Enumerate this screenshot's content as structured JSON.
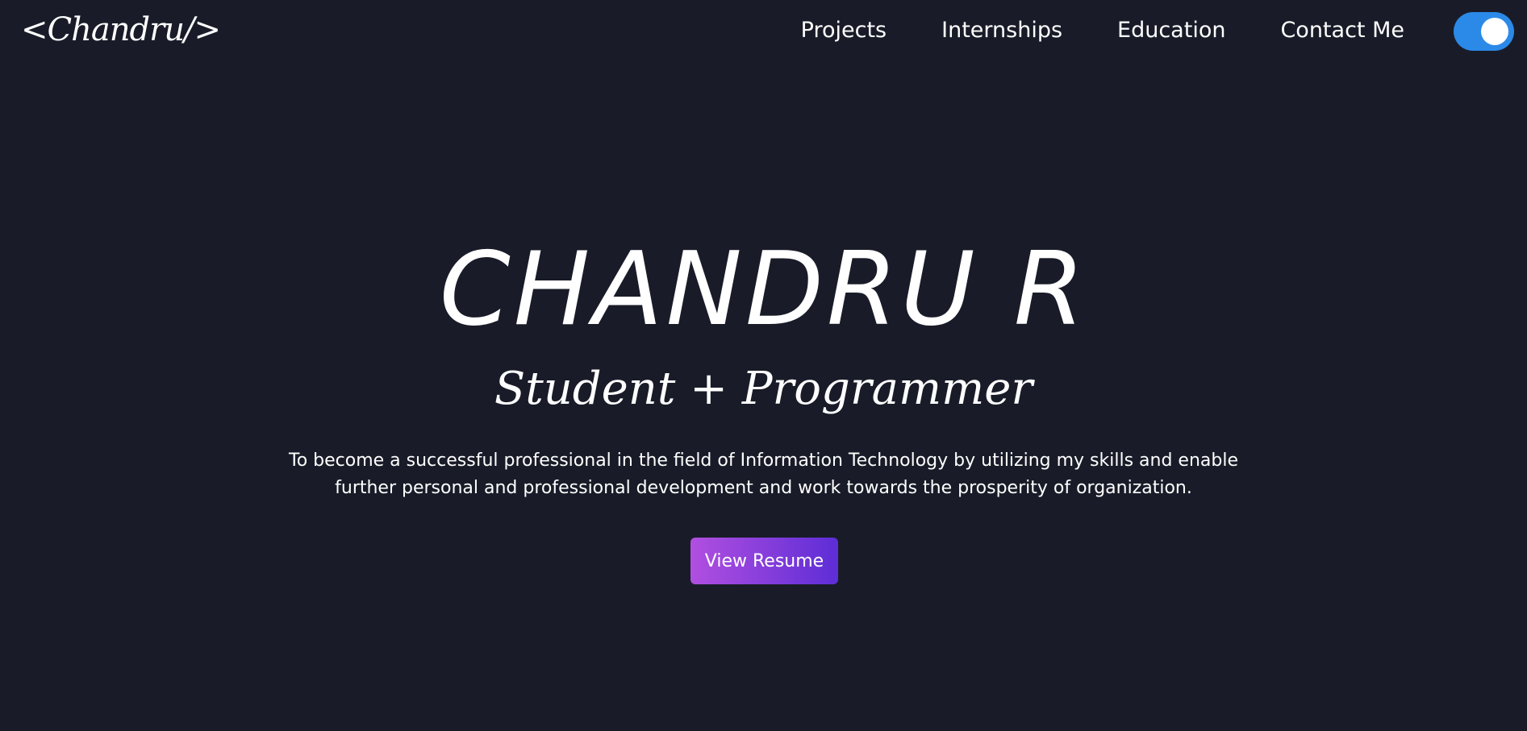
{
  "header": {
    "logo_text": "<Chandru/>",
    "nav": [
      {
        "label": "Projects"
      },
      {
        "label": "Internships"
      },
      {
        "label": "Education"
      },
      {
        "label": "Contact Me"
      }
    ],
    "theme_toggle": {
      "state": "on"
    }
  },
  "hero": {
    "name": "CHANDRU R",
    "role": "Student + Programmer",
    "objective": "To become a successful professional in the field of Information Technology by utilizing my skills and enable further personal and professional development and work towards the prosperity of organization.",
    "resume_button_label": "View Resume"
  },
  "colors": {
    "background": "#191c28",
    "text": "#ffffff",
    "toggle": "#2b8ae8",
    "button_gradient_start": "#b14fe0",
    "button_gradient_end": "#5d2dd6"
  }
}
